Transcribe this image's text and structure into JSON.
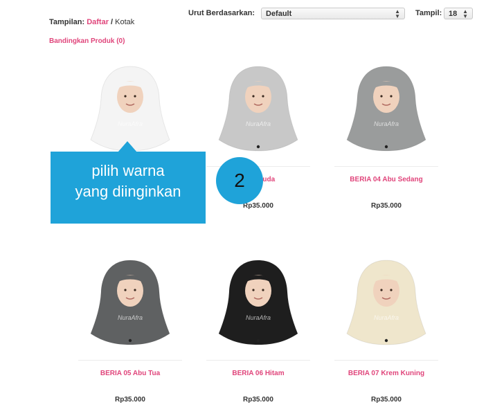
{
  "toolbar": {
    "view_label": "Tampilan:",
    "view_list": "Daftar",
    "view_separator": " / ",
    "view_grid": "Kotak",
    "sort_label": "Urut Berdasarkan:",
    "sort_value": "Default",
    "show_label": "Tampil:",
    "show_value": "18",
    "compare_link": "Bandingkan Produk (0)"
  },
  "products": [
    {
      "name": "",
      "price": "",
      "color": "#f4f4f4"
    },
    {
      "name": "Abu Muda",
      "price": "Rp35.000",
      "color": "#c8c8c8"
    },
    {
      "name": "BERIA 04 Abu Sedang",
      "price": "Rp35.000",
      "color": "#9a9c9c"
    },
    {
      "name": "BERIA 05 Abu Tua",
      "price": "Rp35.000",
      "color": "#5f6162"
    },
    {
      "name": "BERIA 06 Hitam",
      "price": "Rp35.000",
      "color": "#1e1e1e"
    },
    {
      "name": "BERIA 07 Krem Kuning",
      "price": "Rp35.000",
      "color": "#efe6cc"
    }
  ],
  "callout": {
    "line1": "pilih warna",
    "line2": "yang diinginkan",
    "step": "2",
    "color": "#1fa3d9"
  },
  "watermark": "NuraAfra"
}
